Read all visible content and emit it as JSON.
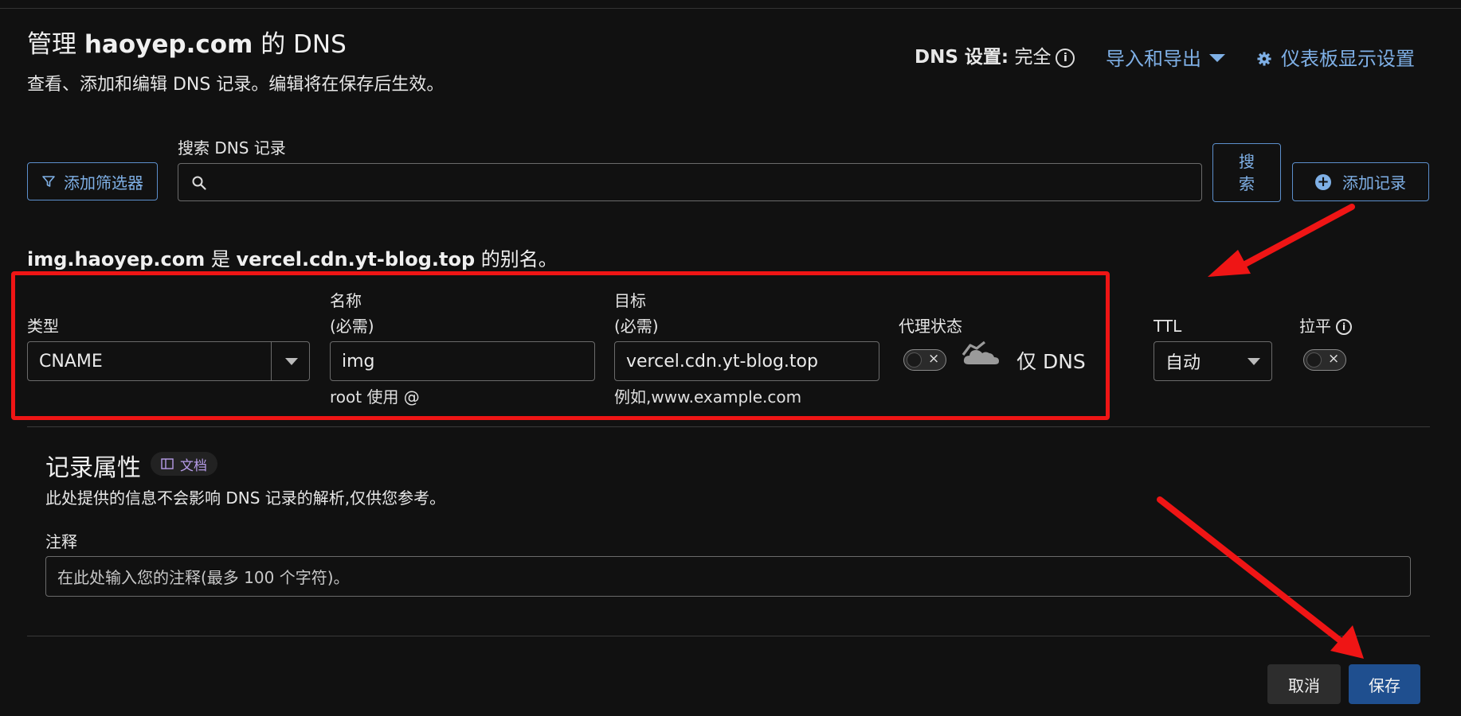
{
  "header": {
    "title_prefix": "管理",
    "domain": "haoyep.com",
    "title_suffix": "的 DNS",
    "subtitle": "查看、添加和编辑 DNS 记录。编辑将在保存后生效。",
    "dns_setting_label": "DNS 设置:",
    "dns_setting_value": "完全",
    "import_export": "导入和导出",
    "dashboard_settings": "仪表板显示设置"
  },
  "toolbar": {
    "add_filter": "添加筛选器",
    "search_label": "搜索 DNS 记录",
    "search_value": "",
    "search_button": "搜索",
    "add_record": "添加记录"
  },
  "record": {
    "alias_name": "img.haoyep.com",
    "alias_is": "是",
    "alias_target": "vercel.cdn.yt-blog.top",
    "alias_suffix": "的别名。",
    "type_label": "类型",
    "type_value": "CNAME",
    "name_label": "名称",
    "name_required": "(必需)",
    "name_value": "img",
    "name_hint": "root 使用 @",
    "target_label": "目标",
    "target_required": "(必需)",
    "target_value": "vercel.cdn.yt-blog.top",
    "target_hint": "例如,www.example.com",
    "proxy_label": "代理状态",
    "proxy_value": "仅 DNS",
    "proxy_on": false,
    "ttl_label": "TTL",
    "ttl_value": "自动",
    "flatten_label": "拉平",
    "flatten_on": false
  },
  "properties": {
    "title": "记录属性",
    "docs_badge": "文档",
    "description": "此处提供的信息不会影响 DNS 记录的解析,仅供您参考。",
    "comment_label": "注释",
    "comment_placeholder": "在此处输入您的注释(最多 100 个字符)。"
  },
  "actions": {
    "cancel": "取消",
    "save": "保存"
  },
  "colors": {
    "background": "#111111",
    "link": "#7fb0e6",
    "primary_button": "#1f4f8f",
    "annotation_red": "#ef1515"
  }
}
